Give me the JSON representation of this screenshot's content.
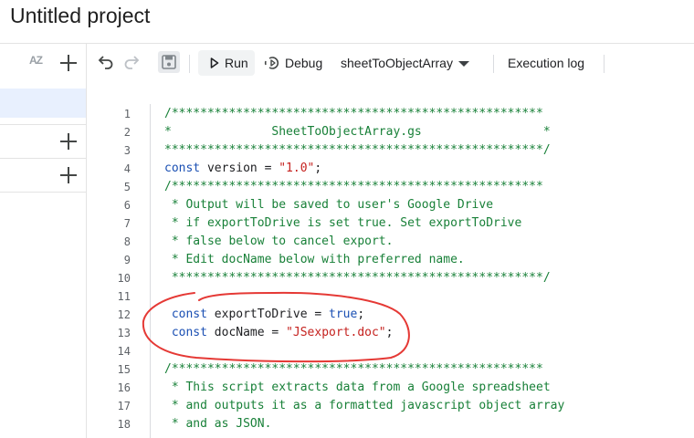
{
  "header": {
    "project_title": "Untitled project"
  },
  "sidebar": {
    "sort_label": "AZ"
  },
  "toolbar": {
    "run_label": "Run",
    "debug_label": "Debug",
    "function_name": "sheetToObjectArray",
    "execution_log_label": "Execution log"
  },
  "editor": {
    "line_numbers": [
      "1",
      "2",
      "3",
      "4",
      "5",
      "6",
      "7",
      "8",
      "9",
      "10",
      "11",
      "12",
      "13",
      "14",
      "15",
      "16",
      "17",
      "18"
    ],
    "lines": [
      {
        "segments": [
          {
            "cls": "cm",
            "text": "/****************************************************"
          }
        ]
      },
      {
        "segments": [
          {
            "cls": "cm",
            "text": "*              SheetToObjectArray.gs                 *"
          }
        ]
      },
      {
        "segments": [
          {
            "cls": "cm",
            "text": "*****************************************************/"
          }
        ]
      },
      {
        "segments": [
          {
            "cls": "kw",
            "text": "const"
          },
          {
            "cls": "",
            "text": " version = "
          },
          {
            "cls": "str",
            "text": "\"1.0\""
          },
          {
            "cls": "",
            "text": ";"
          }
        ]
      },
      {
        "segments": [
          {
            "cls": "cm",
            "text": "/****************************************************"
          }
        ]
      },
      {
        "segments": [
          {
            "cls": "cm",
            "text": " * Output will be saved to user's Google Drive"
          }
        ]
      },
      {
        "segments": [
          {
            "cls": "cm",
            "text": " * if exportToDrive is set true. Set exportToDrive"
          }
        ]
      },
      {
        "segments": [
          {
            "cls": "cm",
            "text": " * false below to cancel export."
          }
        ]
      },
      {
        "segments": [
          {
            "cls": "cm",
            "text": " * Edit docName below with preferred name."
          }
        ]
      },
      {
        "segments": [
          {
            "cls": "cm",
            "text": " ****************************************************/"
          }
        ]
      },
      {
        "segments": [
          {
            "cls": "",
            "text": ""
          }
        ]
      },
      {
        "segments": [
          {
            "cls": "kw",
            "text": " const"
          },
          {
            "cls": "",
            "text": " exportToDrive = "
          },
          {
            "cls": "kw",
            "text": "true"
          },
          {
            "cls": "",
            "text": ";"
          }
        ]
      },
      {
        "segments": [
          {
            "cls": "kw",
            "text": " const"
          },
          {
            "cls": "",
            "text": " docName = "
          },
          {
            "cls": "str",
            "text": "\"JSexport.doc\""
          },
          {
            "cls": "",
            "text": ";"
          }
        ]
      },
      {
        "segments": [
          {
            "cls": "",
            "text": ""
          }
        ]
      },
      {
        "segments": [
          {
            "cls": "cm",
            "text": "/****************************************************"
          }
        ]
      },
      {
        "segments": [
          {
            "cls": "cm",
            "text": " * This script extracts data from a Google spreadsheet"
          }
        ]
      },
      {
        "segments": [
          {
            "cls": "cm",
            "text": " * and outputs it as a formatted javascript object array"
          }
        ]
      },
      {
        "segments": [
          {
            "cls": "cm",
            "text": " * and as JSON."
          }
        ]
      }
    ]
  },
  "colors": {
    "comment": "#188038",
    "keyword": "#1a4fb3",
    "string": "#c5221f",
    "annotation": "#e53935",
    "selection": "#e8f0fe"
  }
}
